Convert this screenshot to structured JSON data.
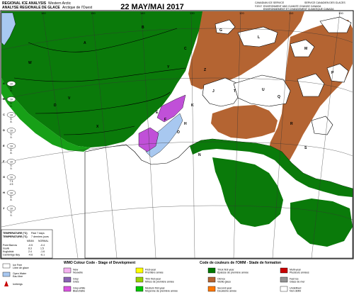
{
  "header": {
    "title_line_en": "REGIONAL ICE ANALYSIS",
    "region_en": "Western Arctic",
    "title_line_fr": "ANALYSE REGIONALE DE GLACE",
    "region_fr": "Arctique de l'Ouest",
    "date": "22 MAY/MAI 2017",
    "agency_en": "CANADIAN ICE SERVICE",
    "agency_fr": "SERVICE CANADIEN DES GLACES",
    "copyright": "©2017",
    "env_en": "ENVIRONMENT AND CLIMATE CHANGE CANADA",
    "env_fr": "ENVIRONNEMENT ET CHANGEMENT CLIMATIQUE CANADA"
  },
  "longitudes": [
    "160",
    "150",
    "140",
    "130",
    "120",
    "110",
    "100"
  ],
  "temperature_table": {
    "title_en": "TEMPERATURE (°C)",
    "title_fr": "TEMPERATURE (°C)",
    "period_en": "Past 7 days",
    "period_fr": "7 derniers jours",
    "col_mean": "MEAN",
    "col_normal": "NORMAL",
    "rows": [
      {
        "station": "Point Barrow",
        "mean": "-0.5",
        "normal": "-0.4"
      },
      {
        "station": "Inuvik",
        "mean": "8.3",
        "normal": "1.5"
      },
      {
        "station": "Kugluktuk",
        "mean": "2.4",
        "normal": "-1.6"
      },
      {
        "station": "Cambridge Bay",
        "mean": "-4.6",
        "normal": "-6.1"
      }
    ]
  },
  "side_legend": [
    {
      "en": "Ice Free",
      "fr": "Libre de glace"
    },
    {
      "en": "Open Water",
      "fr": "Eau libre"
    },
    {
      "en": "Icebergs",
      "fr": "Icebergs"
    }
  ],
  "wmo_legend": {
    "title_en": "WMO Colour Code - Stage of Development",
    "title_fr": "Code de couleurs de l'OMM - Stade de formation",
    "items": [
      {
        "en": "New",
        "fr": "Nouvelle",
        "color": "#f5b3f0"
      },
      {
        "en": "Grey",
        "fr": "Grise",
        "color": "#8a64b4"
      },
      {
        "en": "Grey-white",
        "fr": "Blanchâtre",
        "color": "#d955e0"
      },
      {
        "en": "First-year",
        "fr": "Première année",
        "color": "#ffff00"
      },
      {
        "en": "Thin first-year",
        "fr": "Mince de première année",
        "color": "#9bd200"
      },
      {
        "en": "Medium first-year",
        "fr": "Moyenne de première année",
        "color": "#00c800"
      },
      {
        "en": "Thick first-year",
        "fr": "Épaisse de première année",
        "color": "#007800"
      },
      {
        "en": "Old ice",
        "fr": "Vieille glace",
        "color": "#b46432"
      },
      {
        "en": "Second-year",
        "fr": "Deuxième année",
        "color": "#ff7800"
      },
      {
        "en": "Multi-year",
        "fr": "Plusieurs années",
        "color": "#c80000"
      },
      {
        "en": "Fast ice",
        "fr": "Glace de mer",
        "color": "#969696"
      },
      {
        "en": "Undefined",
        "fr": "Non défini",
        "color": "#ffffff"
      }
    ]
  },
  "region_labels": [
    "A",
    "B",
    "C",
    "D",
    "E",
    "F",
    "G",
    "H",
    "J",
    "K",
    "L",
    "M",
    "N",
    "O",
    "P",
    "Q",
    "R",
    "S",
    "T",
    "U",
    "V",
    "W",
    "X",
    "Y",
    "Z",
    "AA",
    "BB",
    "CC",
    "DD",
    "EE",
    "FF",
    "GG",
    "HH",
    "KK",
    "LL",
    "MM",
    "NN",
    "OO",
    "PP",
    "QQ"
  ],
  "egg_codes": [
    {
      "label": "A",
      "conc": "10",
      "rows": [
        "8.",
        "8."
      ]
    },
    {
      "label": "B",
      "conc": "10",
      "rows": [
        "9.",
        "9."
      ]
    },
    {
      "label": "C",
      "conc": "10",
      "rows": [
        "8.",
        "8."
      ]
    },
    {
      "label": "D",
      "conc": "10",
      "rows": [
        "9.",
        "9."
      ]
    },
    {
      "label": "E",
      "conc": "10",
      "rows": [
        "8.",
        "8."
      ]
    },
    {
      "label": "F",
      "conc": "10",
      "rows": [
        "9.",
        "9."
      ]
    },
    {
      "label": "G",
      "conc": "10",
      "rows": [
        "7 4",
        "4 5"
      ]
    },
    {
      "label": "H",
      "conc": "10",
      "rows": [
        "8.",
        "8."
      ]
    },
    {
      "label": "J",
      "conc": "10",
      "rows": [
        "9.",
        "9."
      ]
    }
  ],
  "colors": {
    "water": "#ffffff",
    "land": "#ffffff",
    "fast_ice": "#0a7a0a",
    "old_ice": "#b46432",
    "open_water": "#a8c8f0",
    "grey_white": "#c050d8",
    "thin_fy": "#17a017",
    "accent_red": "#c80000"
  }
}
